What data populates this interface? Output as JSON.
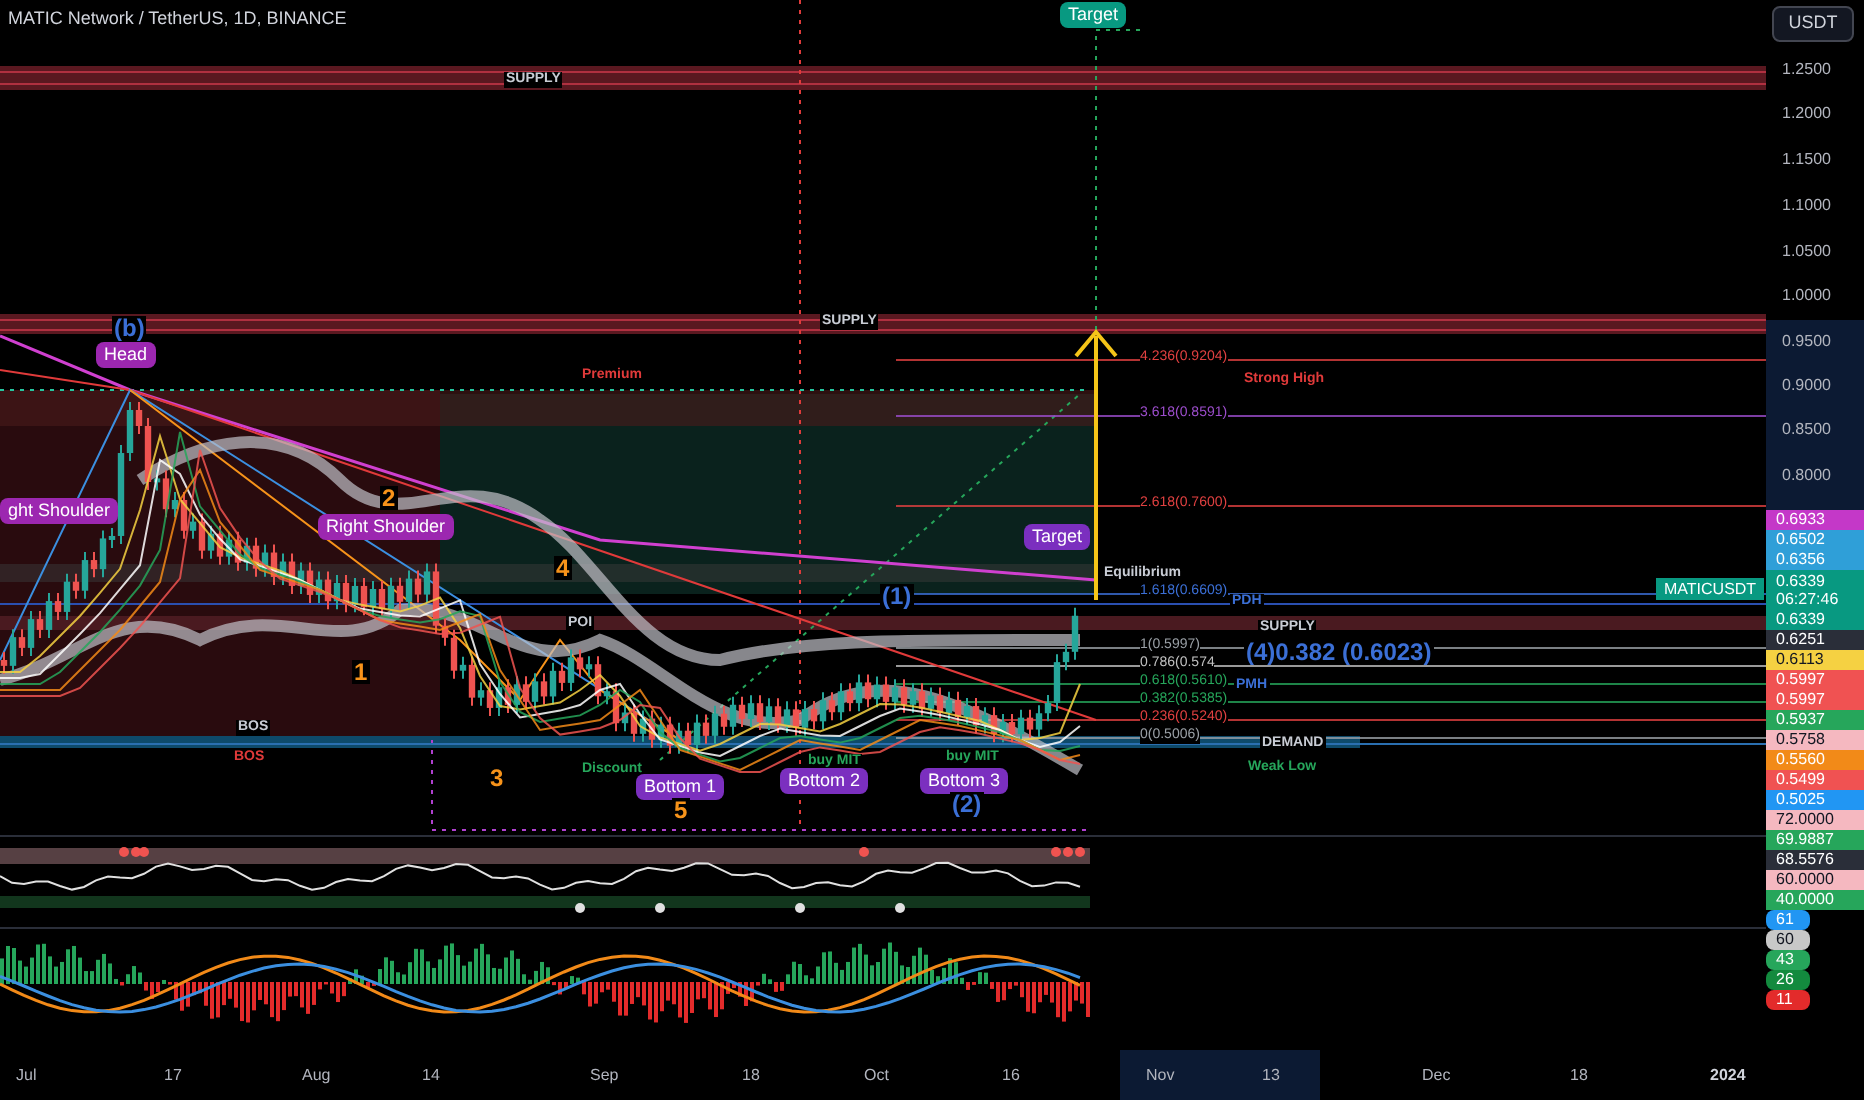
{
  "header": {
    "symbol_title": "MATIC Network / TetherUS, 1D, BINANCE",
    "currency_button": "USDT"
  },
  "price_axis": {
    "ticks": [
      "1.2500",
      "1.2000",
      "1.1500",
      "1.1000",
      "1.0500",
      "1.0000",
      "0.9500",
      "0.9000",
      "0.8500",
      "0.8000"
    ]
  },
  "price_tags": [
    {
      "text": "0.6933",
      "color": "#c438c8",
      "kind": "price"
    },
    {
      "text": "0.6502",
      "color": "#2f9fd8",
      "kind": "price"
    },
    {
      "text": "0.6356",
      "color": "#2f9fd8",
      "kind": "price"
    },
    {
      "text": "0.6339",
      "color": "#089981",
      "kind": "last",
      "symbol": "MATICUSDT",
      "countdown": "06:27:46"
    },
    {
      "text": "0.6339",
      "color": "#089981",
      "kind": "price"
    },
    {
      "text": "0.6251",
      "color": "#2a2e39",
      "kind": "price"
    },
    {
      "text": "0.6113",
      "color": "#f5d142",
      "kind": "price"
    },
    {
      "text": "0.5997",
      "color": "#f05252",
      "kind": "price"
    },
    {
      "text": "0.5997",
      "color": "#f05252",
      "kind": "price"
    },
    {
      "text": "0.5937",
      "color": "#26a65b",
      "kind": "price"
    },
    {
      "text": "0.5758",
      "color": "#f5b8c0",
      "kind": "price"
    },
    {
      "text": "0.5560",
      "color": "#f28a18",
      "kind": "price"
    },
    {
      "text": "0.5499",
      "color": "#f05252",
      "kind": "price"
    },
    {
      "text": "0.5025",
      "color": "#2196f3",
      "kind": "price"
    },
    {
      "text": "72.0000",
      "color": "#f5b8c0",
      "kind": "price"
    },
    {
      "text": "69.9887",
      "color": "#26a65b",
      "kind": "price"
    },
    {
      "text": "68.5576",
      "color": "#2a2e39",
      "kind": "price"
    },
    {
      "text": "60.0000",
      "color": "#f5b8c0",
      "kind": "price"
    },
    {
      "text": "40.0000",
      "color": "#26a65b",
      "kind": "price"
    },
    {
      "text": "61",
      "color": "#2196f3",
      "kind": "oscillator"
    },
    {
      "text": "60",
      "color": "#c8c8c8",
      "kind": "oscillator"
    },
    {
      "text": "43",
      "color": "#26a65b",
      "kind": "oscillator"
    },
    {
      "text": "26",
      "color": "#138a3e",
      "kind": "oscillator"
    },
    {
      "text": "11",
      "color": "#e32b2b",
      "kind": "oscillator"
    }
  ],
  "annotations": [
    {
      "text": "Target",
      "kind": "badge",
      "color": "#089981"
    },
    {
      "text": "SUPPLY",
      "kind": "zone"
    },
    {
      "text": "SUPPLY",
      "kind": "zone"
    },
    {
      "text": "(b)",
      "kind": "wave_count"
    },
    {
      "text": "Head",
      "kind": "badge",
      "color": "#9c27b0"
    },
    {
      "text": "Premium",
      "kind": "bearish"
    },
    {
      "text": "Strong High",
      "kind": "bearish"
    },
    {
      "text": "2",
      "kind": "wave"
    },
    {
      "text": "ght Shoulder",
      "kind": "badge",
      "color": "#9c27b0"
    },
    {
      "text": "Right Shoulder",
      "kind": "badge",
      "color": "#9c27b0"
    },
    {
      "text": "Target",
      "kind": "badge",
      "color": "#7b2fbf"
    },
    {
      "text": "4",
      "kind": "wave"
    },
    {
      "text": "Equilibrium",
      "kind": "zone"
    },
    {
      "text": "(1)",
      "kind": "wave_count"
    },
    {
      "text": "PDH",
      "kind": "level"
    },
    {
      "text": "POI",
      "kind": "zone"
    },
    {
      "text": "SUPPLY",
      "kind": "zone"
    },
    {
      "text": "(4)0.382 (0.6023)",
      "kind": "wave_count"
    },
    {
      "text": "1",
      "kind": "wave"
    },
    {
      "text": "PMH",
      "kind": "level"
    },
    {
      "text": "BOS",
      "kind": "zone"
    },
    {
      "text": "DEMAND",
      "kind": "zone"
    },
    {
      "text": "BOS",
      "kind": "bearish"
    },
    {
      "text": "buy MIT",
      "kind": "bullish"
    },
    {
      "text": "buy MIT",
      "kind": "bullish"
    },
    {
      "text": "Weak Low",
      "kind": "bullish"
    },
    {
      "text": "3",
      "kind": "wave"
    },
    {
      "text": "Discount",
      "kind": "bullish"
    },
    {
      "text": "Bottom 1",
      "kind": "badge",
      "color": "#7b2fbf"
    },
    {
      "text": "Bottom 2",
      "kind": "badge",
      "color": "#7b2fbf"
    },
    {
      "text": "Bottom 3",
      "kind": "badge",
      "color": "#7b2fbf"
    },
    {
      "text": "5",
      "kind": "wave"
    },
    {
      "text": "(2)",
      "kind": "wave_count"
    }
  ],
  "fib_levels": [
    {
      "text": "4.236(0.9204)",
      "color": "#e04040"
    },
    {
      "text": "3.618(0.8591)",
      "color": "#9c4dcc"
    },
    {
      "text": "2.618(0.7600)",
      "color": "#e04040"
    },
    {
      "text": "1.618(0.6609)",
      "color": "#3b6fd6"
    },
    {
      "text": "1(0.5997)",
      "color": "#9aa0a6"
    },
    {
      "text": "0.786(0.574",
      "color": "#c0c0c0"
    },
    {
      "text": "0.618(0.5610)",
      "color": "#26a65b"
    },
    {
      "text": "0.382(0.5385)",
      "color": "#26a65b"
    },
    {
      "text": "0.236(0.5240)",
      "color": "#e04040"
    },
    {
      "text": "0(0.5006)",
      "color": "#9aa0a6"
    }
  ],
  "time_axis": {
    "labels": [
      {
        "text": "Jul",
        "bold": false,
        "highlighted": false
      },
      {
        "text": "17",
        "bold": false,
        "highlighted": false
      },
      {
        "text": "Aug",
        "bold": false,
        "highlighted": false
      },
      {
        "text": "14",
        "bold": false,
        "highlighted": false
      },
      {
        "text": "Sep",
        "bold": false,
        "highlighted": false
      },
      {
        "text": "18",
        "bold": false,
        "highlighted": false
      },
      {
        "text": "Oct",
        "bold": false,
        "highlighted": false
      },
      {
        "text": "16",
        "bold": false,
        "highlighted": false
      },
      {
        "text": "Nov",
        "bold": false,
        "highlighted": true
      },
      {
        "text": "13",
        "bold": false,
        "highlighted": true
      },
      {
        "text": "Dec",
        "bold": false,
        "highlighted": false
      },
      {
        "text": "18",
        "bold": false,
        "highlighted": false
      },
      {
        "text": "2024",
        "bold": true,
        "highlighted": false
      }
    ]
  }
}
